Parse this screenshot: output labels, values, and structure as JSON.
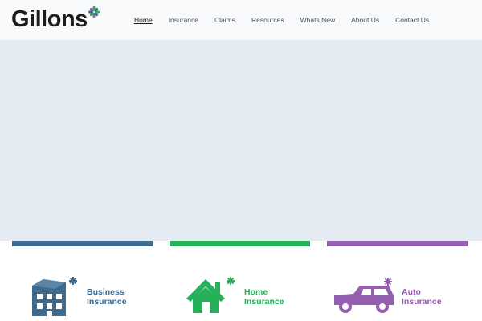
{
  "brand": {
    "name": "Gillons",
    "colors": {
      "text": "#1d1d1f",
      "business": "#3e6a8e",
      "home": "#27b05a",
      "auto": "#935fae",
      "hero": "#e4ebf2",
      "header": "#f7f9fb"
    }
  },
  "nav": {
    "items": [
      {
        "label": "Home",
        "active": true
      },
      {
        "label": "Insurance"
      },
      {
        "label": "Claims"
      },
      {
        "label": "Resources"
      },
      {
        "label": "Whats New"
      },
      {
        "label": "About Us"
      },
      {
        "label": "Contact Us"
      }
    ]
  },
  "cards": [
    {
      "line1": "Business",
      "line2": "Insurance",
      "icon": "building-icon"
    },
    {
      "line1": "Home",
      "line2": "Insurance",
      "icon": "house-icon"
    },
    {
      "line1": "Auto",
      "line2": "Insurance",
      "icon": "car-icon"
    }
  ]
}
